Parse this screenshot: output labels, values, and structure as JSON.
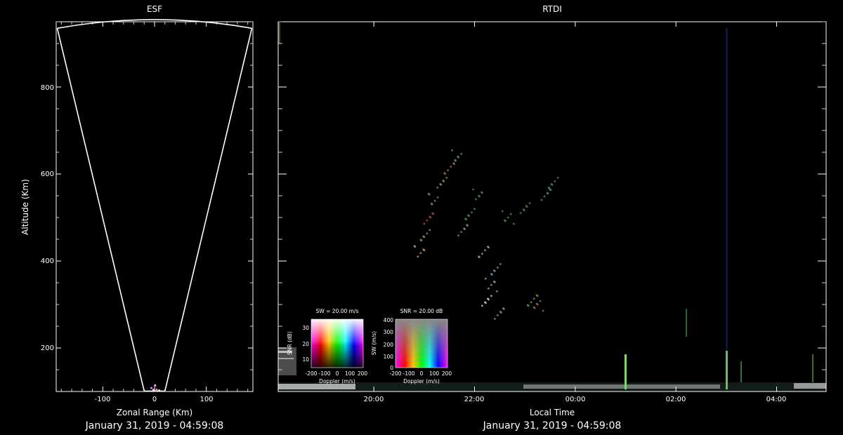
{
  "colors": {
    "background": "#000000",
    "axis": "#ffffff",
    "tick": "#d8d8d8"
  },
  "chart_data": [
    {
      "type": "scatter",
      "title": "ESF",
      "xlabel": "Zonal Range (Km)",
      "ylabel": "Altitude (Km)",
      "footer": "January 31, 2019 - 04:59:08",
      "xlim": [
        -190,
        190
      ],
      "ylim": [
        100,
        950
      ],
      "xticks": [
        {
          "v": -100,
          "label": "-100"
        },
        {
          "v": 0,
          "label": "0"
        },
        {
          "v": 100,
          "label": "100"
        }
      ],
      "yticks": [
        {
          "v": 200,
          "label": "200"
        },
        {
          "v": 400,
          "label": "400"
        },
        {
          "v": 600,
          "label": "600"
        },
        {
          "v": 800,
          "label": "800"
        }
      ],
      "sector": {
        "outer_left": [
          -188,
          935
        ],
        "outer_top": [
          0,
          955
        ],
        "outer_right": [
          188,
          935
        ],
        "inner_left": [
          -20,
          101
        ],
        "inner_right": [
          20,
          101
        ]
      },
      "points": [
        {
          "x": -2,
          "y": 103,
          "c": "#ffffff"
        },
        {
          "x": 4,
          "y": 104,
          "c": "#ff77aa"
        },
        {
          "x": -6,
          "y": 108,
          "c": "#cc88ff"
        },
        {
          "x": 1,
          "y": 114,
          "c": "#ffaacc"
        },
        {
          "x": 9,
          "y": 102,
          "c": "#ffffff"
        }
      ]
    },
    {
      "type": "scatter",
      "title": "RTDI",
      "xlabel": "Local Time",
      "ylabel": "",
      "footer": "January 31, 2019 - 04:59:08",
      "xlim": [
        "18:06",
        "04:59"
      ],
      "ylim": [
        100,
        950
      ],
      "xticks": [
        {
          "v": "20:00",
          "label": "20:00"
        },
        {
          "v": "22:00",
          "label": "22:00"
        },
        {
          "v": "00:00",
          "label": "00:00"
        },
        {
          "v": "02:00",
          "label": "02:00"
        },
        {
          "v": "04:00",
          "label": "04:00"
        }
      ],
      "yticks": [
        200,
        400,
        600,
        800
      ],
      "echo_clusters": [
        {
          "t": "20:55",
          "alt": 420,
          "c": "#c9a070"
        },
        {
          "t": "21:00",
          "alt": 460,
          "c": "#8fa060"
        },
        {
          "t": "21:05",
          "alt": 500,
          "c": "#b05a40"
        },
        {
          "t": "21:12",
          "alt": 540,
          "c": "#6a9a50"
        },
        {
          "t": "21:20",
          "alt": 580,
          "c": "#7aa060"
        },
        {
          "t": "21:30",
          "alt": 615,
          "c": "#a07060"
        },
        {
          "t": "21:40",
          "alt": 640,
          "c": "#5a9a60"
        },
        {
          "t": "21:45",
          "alt": 470,
          "c": "#9a8a70"
        },
        {
          "t": "21:55",
          "alt": 510,
          "c": "#4a9a5a"
        },
        {
          "t": "22:05",
          "alt": 550,
          "c": "#5a8a50"
        },
        {
          "t": "22:10",
          "alt": 420,
          "c": "#aaaaaa"
        },
        {
          "t": "22:15",
          "alt": 310,
          "c": "#cfd8e0"
        },
        {
          "t": "22:20",
          "alt": 345,
          "c": "#9aaab0"
        },
        {
          "t": "22:25",
          "alt": 380,
          "c": "#6aa0c0"
        },
        {
          "t": "22:30",
          "alt": 280,
          "c": "#7aa0b0"
        },
        {
          "t": "22:40",
          "alt": 500,
          "c": "#4a9a5a"
        },
        {
          "t": "23:00",
          "alt": 520,
          "c": "#5a8a50"
        },
        {
          "t": "23:10",
          "alt": 310,
          "c": "#7a9a40"
        },
        {
          "t": "23:15",
          "alt": 300,
          "c": "#a07a40"
        },
        {
          "t": "23:25",
          "alt": 550,
          "c": "#5a9a60"
        },
        {
          "t": "23:35",
          "alt": 580,
          "c": "#4a8a60"
        }
      ],
      "colorbars": [
        {
          "title": "SW = 20.00 m/s",
          "xlabel": "Doppler (m/s)",
          "ylabel": "SNR (dB)",
          "xticks": [
            "-200",
            "-100",
            "0",
            "100",
            "200"
          ],
          "yticks": [
            "10",
            "20",
            "30"
          ]
        },
        {
          "title": "SNR = 20.00 dB",
          "xlabel": "Doppler (m/s)",
          "ylabel": "SW (m/s)",
          "xticks": [
            "-200",
            "-100",
            "0",
            "100",
            "200"
          ],
          "yticks": [
            "0",
            "100",
            "200",
            "300",
            "400"
          ]
        }
      ]
    }
  ]
}
